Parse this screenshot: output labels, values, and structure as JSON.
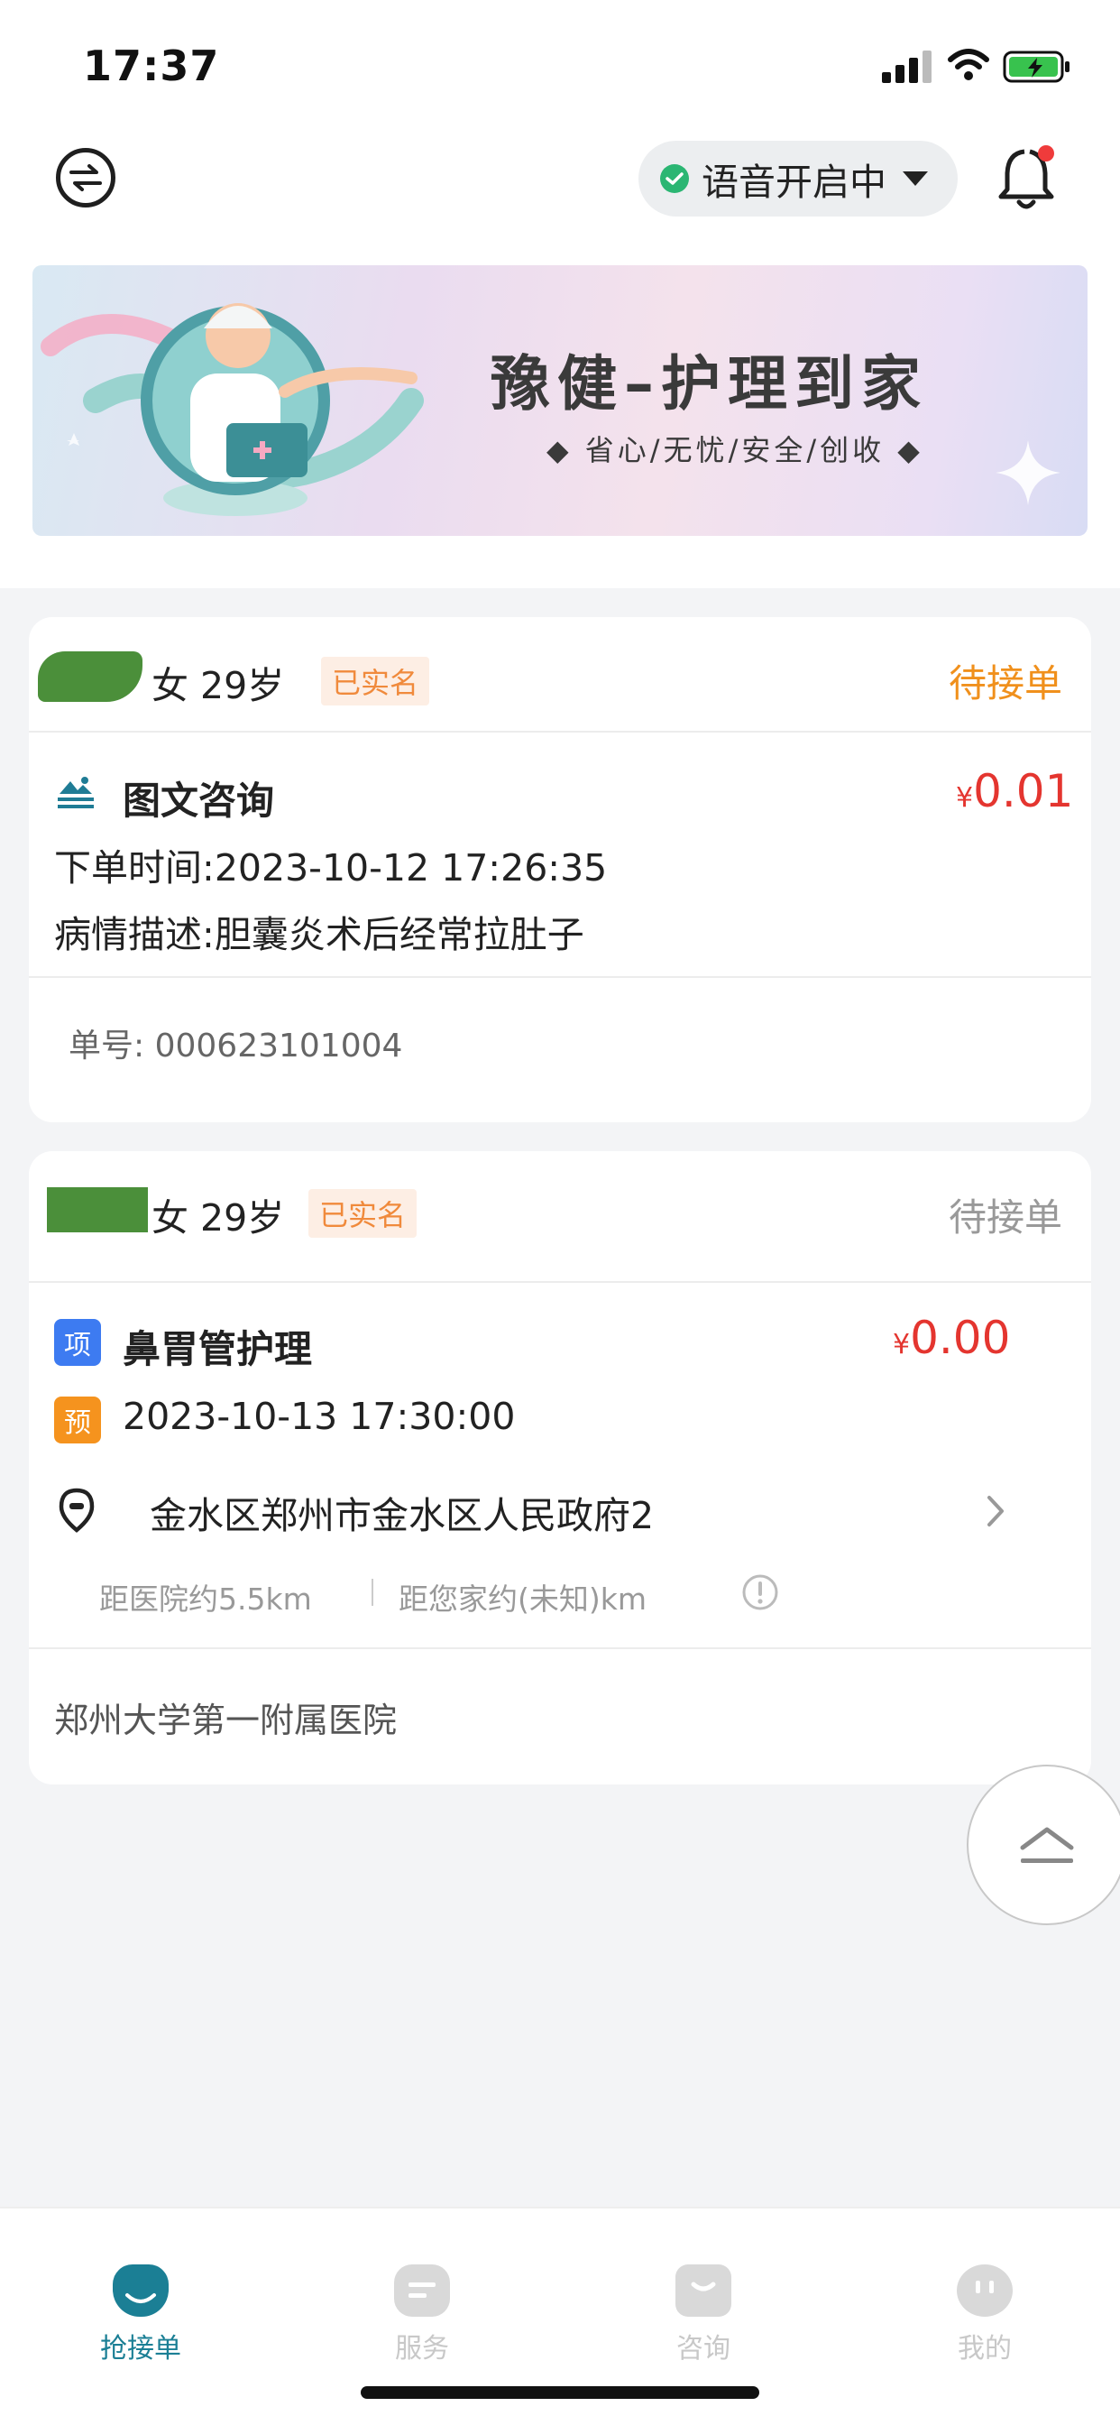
{
  "status_bar": {
    "time": "17:37"
  },
  "header": {
    "voice_label": "语音开启中"
  },
  "banner": {
    "title": "豫健–护理到家",
    "subtitle": "◆ 省心/无忧/安全/创收 ◆"
  },
  "orders": [
    {
      "patient": "女 29岁",
      "verified_badge": "已实名",
      "status": "待接单",
      "status_color": "#f0901c",
      "service": "图文咨询",
      "currency": "¥",
      "price": "0.01",
      "order_time": "下单时间:2023-10-12 17:26:35",
      "description": "病情描述:胆囊炎术后经常拉肚子",
      "order_no": "单号:  000623101004"
    },
    {
      "patient": "女 29岁",
      "verified_badge": "已实名",
      "status": "待接单",
      "status_color": "#999999",
      "project_tag": "项",
      "service": "鼻胃管护理",
      "currency": "¥",
      "price": "0.00",
      "reserve_tag": "预",
      "appointment": "2023-10-13 17:30:00",
      "address": "金水区郑州市金水区人民政府2",
      "dist_hospital": "距医院约5.5km",
      "dist_home": "距您家约(未知)km",
      "hospital": "郑州大学第一附属医院"
    }
  ],
  "tabbar": {
    "items": [
      {
        "label": "抢接单",
        "active": true
      },
      {
        "label": "服务",
        "active": false
      },
      {
        "label": "咨询",
        "active": false
      },
      {
        "label": "我的",
        "active": false
      }
    ]
  },
  "colors": {
    "accent": "#1b7f95",
    "price": "#e4352f",
    "pending_orange": "#f0901c",
    "voice_on": "#2bb673"
  }
}
